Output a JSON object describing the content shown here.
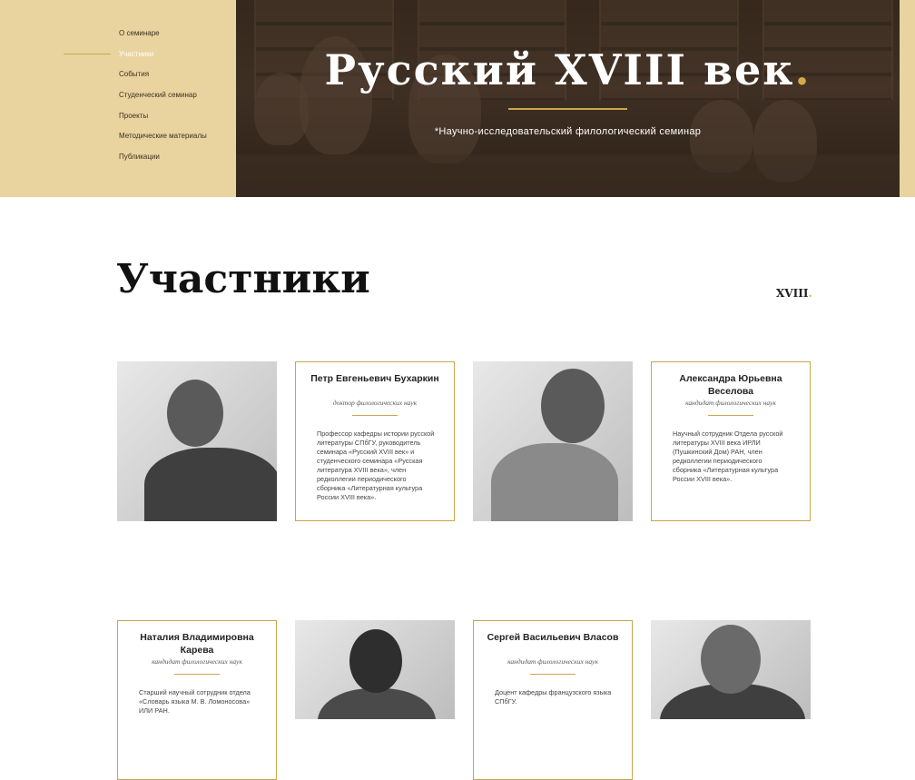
{
  "nav": {
    "items": [
      {
        "label": "О семинаре",
        "active": false
      },
      {
        "label": "Участники",
        "active": true
      },
      {
        "label": "События",
        "active": false
      },
      {
        "label": "Студенческий семинар",
        "active": false
      },
      {
        "label": "Проекты",
        "active": false
      },
      {
        "label": "Методические материалы",
        "active": false
      },
      {
        "label": "Публикации",
        "active": false
      }
    ]
  },
  "hero": {
    "title": "Русский XVIII век",
    "title_dot": ".",
    "subtitle": "*Научно-исследовательский филологический семинар"
  },
  "page": {
    "title": "Участники",
    "mini_logo": "XVIII",
    "mini_logo_dot": "."
  },
  "members": [
    {
      "name": "Петр Евгеньевич Бухаркин",
      "degree": "доктор филологических наук",
      "bio": "Профессор кафедры истории русской литературы СПбГУ, руководитель семинара «Русский XVIII век» и студенческого семинара «Русская литература XVIII века», член редколлегии периодического сборника «Литературная культура России XVIII века»."
    },
    {
      "name": "Александра Юрьевна Веселова",
      "degree": "кандидат филологических наук",
      "bio": "Научный сотрудник Отдела русской литературы XVIII века ИРЛИ (Пушкинский Дом) РАН, член редколлегии периодического сборника «Литературная культура России XVIII века»."
    },
    {
      "name": "Наталия Владимировна Карева",
      "degree": "кандидат филологических наук",
      "bio": "Старший научный сотрудник отдела «Словарь языка М. В. Ломоносова» ИЛИ РАН."
    },
    {
      "name": "Сергей Васильевич Власов",
      "degree": "кандидат филологических наук",
      "bio": "Доцент кафедры французского языка СПбГУ."
    }
  ],
  "colors": {
    "accent_gold": "#c9a64e",
    "nav_background": "#e9d4a0",
    "hero_dark": "#3d2e22"
  }
}
